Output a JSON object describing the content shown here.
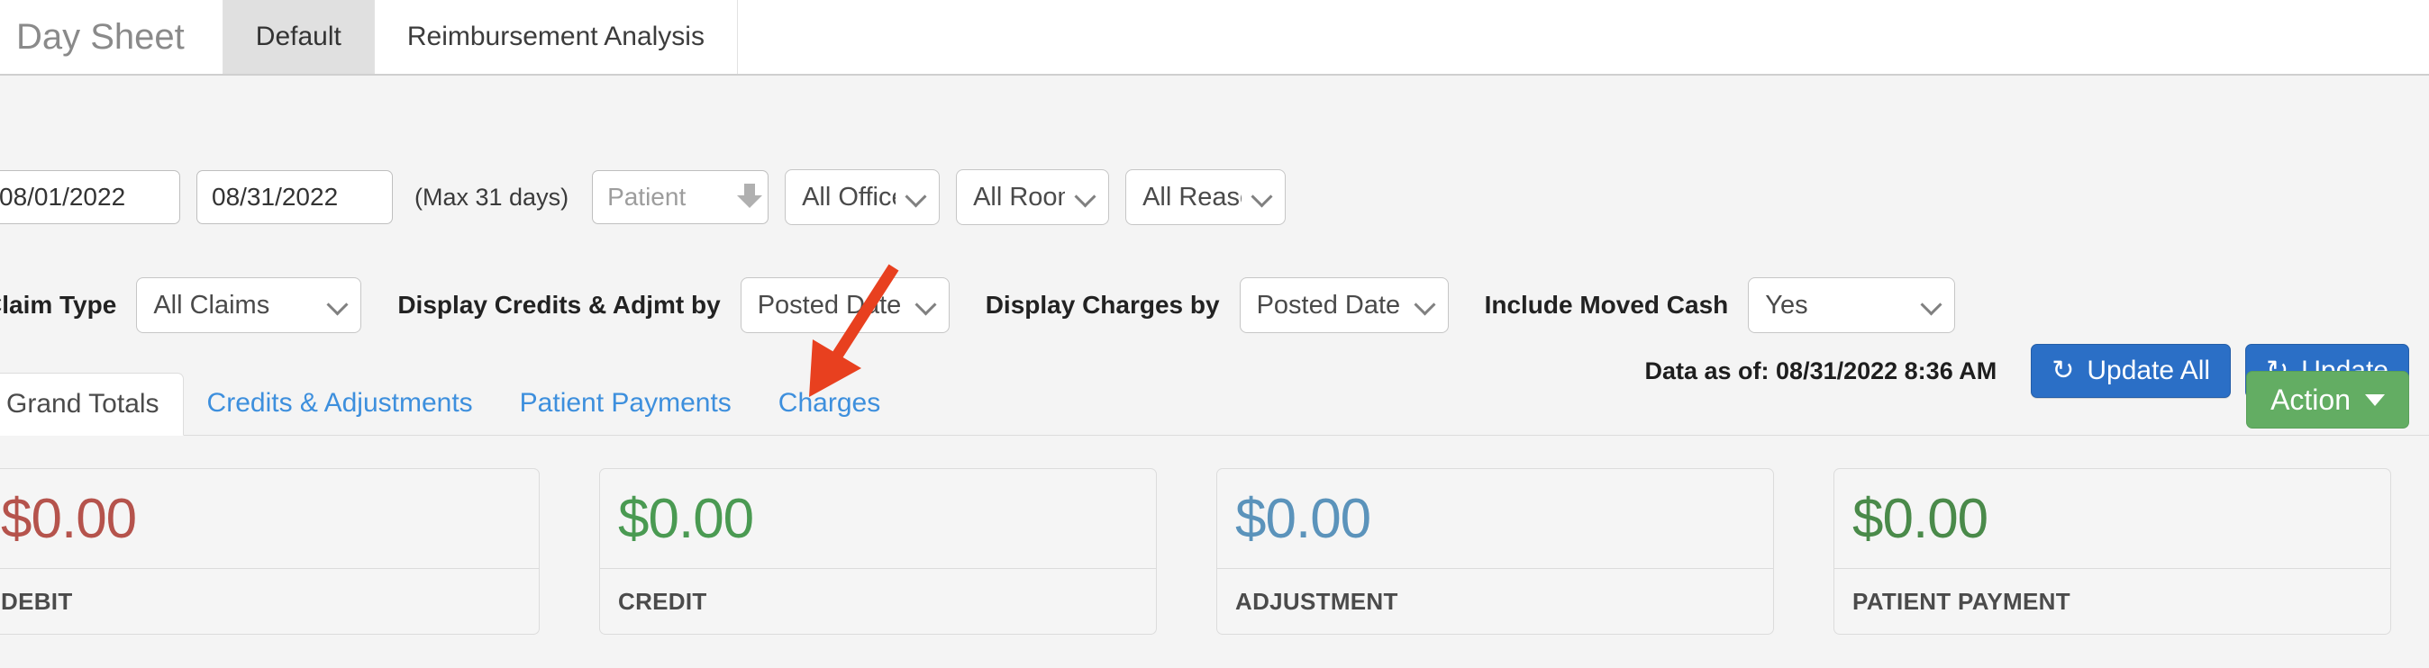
{
  "window": {
    "title": "Day Sheet",
    "tabs": [
      {
        "label": "Default",
        "active": true
      },
      {
        "label": "Reimbursement Analysis",
        "active": false
      }
    ]
  },
  "filters": {
    "date_from": "08/01/2022",
    "date_to": "08/31/2022",
    "max_days_note": "(Max 31 days)",
    "patient_placeholder": "Patient",
    "office": "All Office",
    "room": "All Room",
    "reason": "All Reaso",
    "claim_type_label": "Claim Type",
    "claim_type_value": "All Claims",
    "credits_label": "Display Credits & Adjmt by",
    "credits_value": "Posted Date",
    "charges_label": "Display Charges by",
    "charges_value": "Posted Date",
    "moved_cash_label": "Include Moved Cash",
    "moved_cash_value": "Yes"
  },
  "status": {
    "data_as_of": "Data as of: 08/31/2022 8:36 AM",
    "update_all_label": "Update All",
    "update_label": "Update",
    "refresh_icon": "↻"
  },
  "content_tabs": [
    {
      "label": "Grand Totals",
      "active": true
    },
    {
      "label": "Credits & Adjustments",
      "active": false
    },
    {
      "label": "Patient Payments",
      "active": false
    },
    {
      "label": "Charges",
      "active": false
    }
  ],
  "action_button": {
    "label": "Action"
  },
  "cards": [
    {
      "amount": "$0.00",
      "label": "DEBIT",
      "color": "#b5534c"
    },
    {
      "amount": "$0.00",
      "label": "CREDIT",
      "color": "#4a9a52"
    },
    {
      "amount": "$0.00",
      "label": "ADJUSTMENT",
      "color": "#5b93bb"
    },
    {
      "amount": "$0.00",
      "label": "PATIENT PAYMENT",
      "color": "#4a8a4a"
    }
  ],
  "annotation": {
    "arrow_color": "#e8401f",
    "points_to": "Charges"
  },
  "colors": {
    "primary_blue": "#2b6fc6",
    "link_blue": "#3d8fdd",
    "action_green": "#63ad63",
    "annotation_red": "#e8401f"
  }
}
